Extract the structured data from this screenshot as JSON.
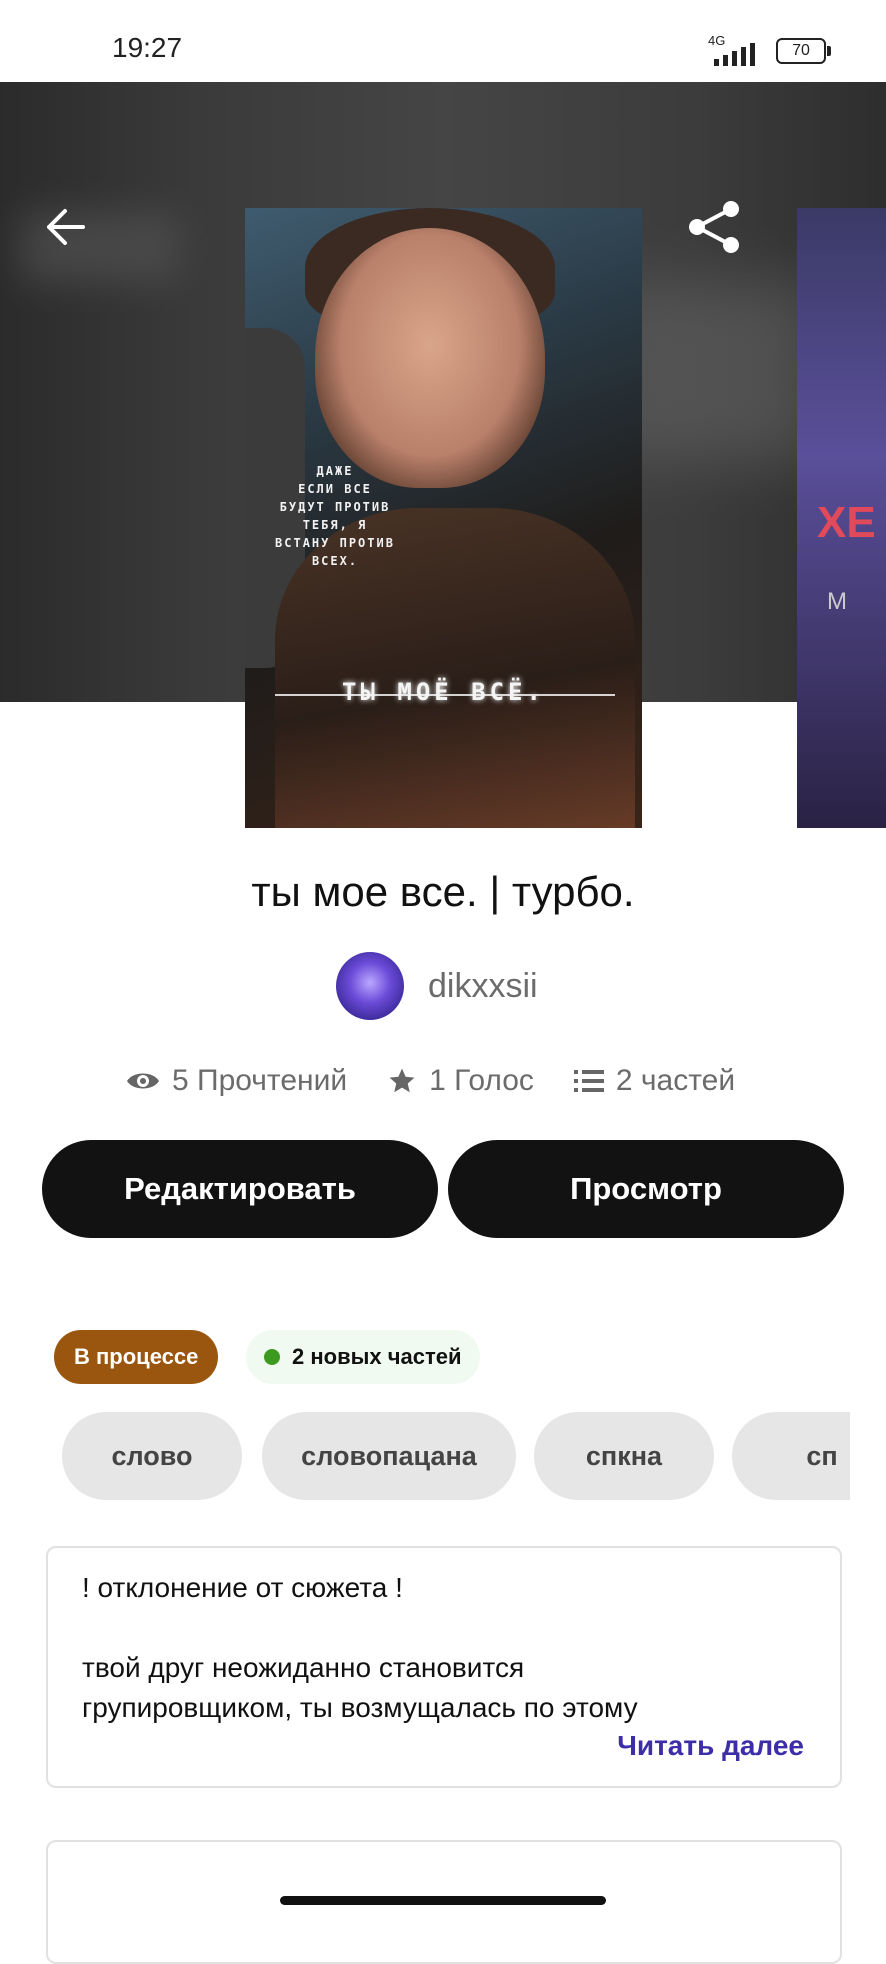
{
  "status_bar": {
    "time": "19:27",
    "network": "4G",
    "battery": "70"
  },
  "story": {
    "cover_quote": "ДАЖЕ\nЕСЛИ ВСЕ\nБУДУТ ПРОТИВ\nТЕБЯ, Я\nВСТАНУ ПРОТИВ\nВСЕХ.",
    "cover_title": "ТЫ МОЁ ВСЁ.",
    "next_cover_text": "ХЕ",
    "next_cover_sub": "М",
    "title": "ты мое все. | турбо.",
    "author": "dikxxsii"
  },
  "stats": {
    "reads": "5 Прочтений",
    "votes": "1 Голос",
    "parts": "2 частей"
  },
  "actions": {
    "edit": "Редактировать",
    "view": "Просмотр"
  },
  "badges": {
    "status": "В процессе",
    "new_parts": "2 новых частей"
  },
  "tags": [
    "слово",
    "словопацана",
    "спкна",
    "сп"
  ],
  "description": {
    "text": "! отклонение от сюжета !\n\nтвой друг неожиданно становится\nгрупировщиком, ты возмущалась по этому",
    "read_more": "Читать далее"
  },
  "icons": [
    "back-arrow-icon",
    "share-icon",
    "more-vertical-icon",
    "eye-icon",
    "star-icon",
    "list-icon"
  ]
}
